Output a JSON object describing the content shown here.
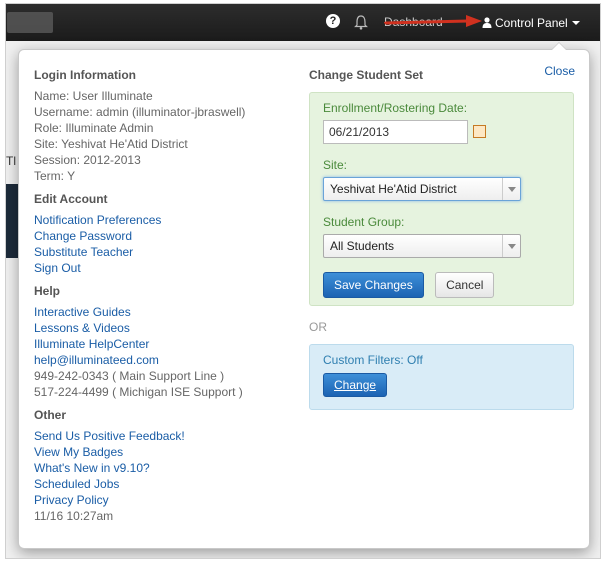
{
  "topbar": {
    "help_glyph": "?",
    "dashboard_label": "Dashboard",
    "control_panel_label": "Control Panel",
    "accent_arrow_color": "#d0311f"
  },
  "background": {
    "partial_text": "Tl"
  },
  "panel": {
    "close_label": "Close",
    "login": {
      "heading": "Login Information",
      "lines": [
        "Name: User Illuminate",
        "Username: admin (illuminator-jbraswell)",
        "Role: Illuminate Admin",
        "Site: Yeshivat He'Atid District",
        "Session: 2012-2013",
        "Term: Y"
      ]
    },
    "edit_account": {
      "heading": "Edit Account",
      "links": [
        "Notification Preferences",
        "Change Password",
        "Substitute Teacher",
        "Sign Out"
      ]
    },
    "help": {
      "heading": "Help",
      "links": [
        "Interactive Guides",
        "Lessons & Videos",
        "Illuminate HelpCenter",
        "help@illuminateed.com"
      ],
      "phones": [
        "949-242-0343 ( Main Support Line )",
        "517-224-4499 ( Michigan ISE Support )"
      ]
    },
    "other": {
      "heading": "Other",
      "links": [
        "Send Us Positive Feedback!",
        "View My Badges",
        "What's New in v9.10?",
        "Scheduled Jobs",
        "Privacy Policy"
      ],
      "timestamp": "11/16 10:27am"
    },
    "student_set": {
      "heading": "Change Student Set",
      "date_label": "Enrollment/Rostering Date:",
      "date_value": "06/21/2013",
      "site_label": "Site:",
      "site_value": "Yeshivat He'Atid District",
      "group_label": "Student Group:",
      "group_value": "All Students",
      "save_label": "Save Changes",
      "cancel_label": "Cancel",
      "or_label": "OR",
      "custom_filters_label": "Custom Filters: Off",
      "change_label": "Change"
    }
  }
}
